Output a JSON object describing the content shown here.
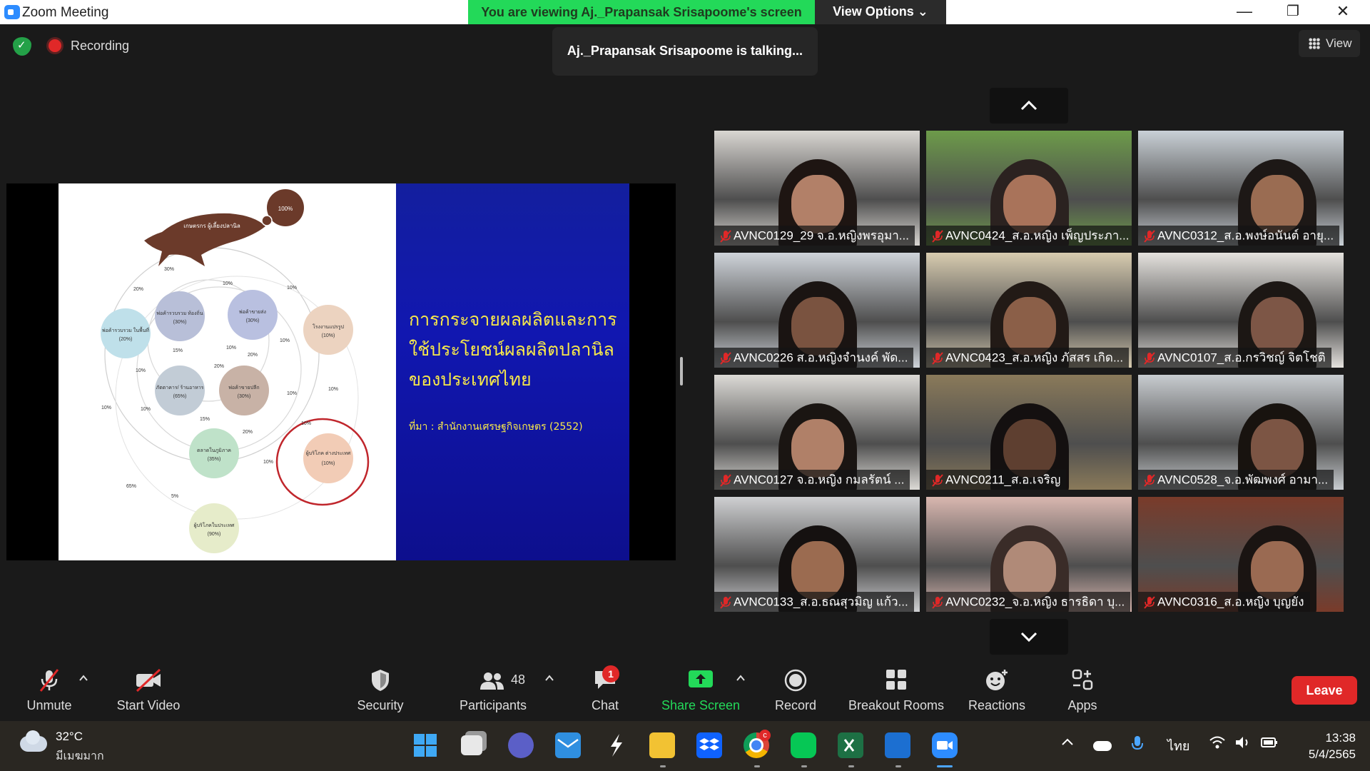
{
  "window": {
    "title": "Zoom Meeting",
    "sharing_banner": "You are viewing Aj._Prapansak  Srisapoome's screen",
    "view_options": "View Options ⌄",
    "minimize": "—",
    "maximize": "❐",
    "close": "✕"
  },
  "status": {
    "recording_label": "Recording",
    "talking_label": "Aj._Prapansak  Srisapoome is talking...",
    "view_label": "View"
  },
  "slide": {
    "heading": "การกระจายผลผลิตและการใช้ประโยชน์ผลผลิตปลานิล ของประเทศไทย",
    "source": "ที่มา : สำนักงานเศรษฐกิจเกษตร (2552)",
    "diagram": {
      "fish_label": "เกษตรกร ผู้เลี้ยงปลานิล",
      "fish_pct": "100%",
      "nodes": [
        {
          "label": "พ่อค้ารวบรวม ในพื้นที่",
          "pct": "(20%)"
        },
        {
          "label": "พ่อค้ารวบรวม ท้องถิ่น",
          "pct": "(30%)"
        },
        {
          "label": "พ่อค้าขายส่ง",
          "pct": "(30%)"
        },
        {
          "label": "โรงงานแปรรูป",
          "pct": "(10%)"
        },
        {
          "label": "ภัตตาคาร/ ร้านอาหาร",
          "pct": "(65%)"
        },
        {
          "label": "พ่อค้าขายปลีก",
          "pct": "(30%)"
        },
        {
          "label": "ตลาดในภูมิภาค",
          "pct": "(35%)"
        },
        {
          "label": "ผู้บริโภค ต่างประเทศ",
          "pct": "(10%)"
        },
        {
          "label": "ผู้บริโภคในประเทศ",
          "pct": "(90%)"
        }
      ],
      "flow_labels": [
        "30%",
        "10%",
        "10%",
        "20%",
        "15%",
        "10%",
        "20%",
        "10%",
        "10%",
        "10%",
        "20%",
        "15%",
        "20%",
        "10%",
        "10%",
        "10%",
        "65%",
        "5%",
        "10%",
        "10%"
      ]
    }
  },
  "participants": [
    {
      "name": "AVNC0129_29 จ.อ.หญิงพรอุมา...",
      "bg": "#d9d6d2",
      "skin": "#b28068",
      "hair": "#1e1512"
    },
    {
      "name": "AVNC0424_ส.อ.หญิง เพ็ญประภา...",
      "bg": "#6d9b4a",
      "skin": "#a9735a",
      "hair": "#2b2220"
    },
    {
      "name": "AVNC0312_ส.อ.พงษ์อนันต์ อายุ...",
      "bg": "#c9d0d6",
      "skin": "#9a6c52",
      "hair": "#1d1816"
    },
    {
      "name": "AVNC0226 ส.อ.หญิงจำนงค์ พัด...",
      "bg": "#cfd4da",
      "skin": "#7a5340",
      "hair": "#1a1412"
    },
    {
      "name": "AVNC0423_ส.อ.หญิง ภัสสร เกิด...",
      "bg": "#d8ccb0",
      "skin": "#8b5f48",
      "hair": "#221a16"
    },
    {
      "name": "AVNC0107_ส.อ.กรวิชญ์ จิตโชติ",
      "bg": "#e5e2de",
      "skin": "#7d5646",
      "hair": "#1c1714"
    },
    {
      "name": "AVNC0127 จ.อ.หญิง กมลรัตน์ ...",
      "bg": "#dcdad6",
      "skin": "#b08068",
      "hair": "#1a1512"
    },
    {
      "name": "AVNC0211_ส.อ.เจริญ",
      "bg": "#8a7a5a",
      "skin": "#5e3f30",
      "hair": "#141010"
    },
    {
      "name": "AVNC0528_จ.อ.พัฒพงศ์ อามา...",
      "bg": "#c8ccd0",
      "skin": "#7c5544",
      "hair": "#18130f"
    },
    {
      "name": "AVNC0133_ส.อ.ธณสุวมิญ แก้ว...",
      "bg": "#cfd0d2",
      "skin": "#9b6b50",
      "hair": "#151110"
    },
    {
      "name": "AVNC0232_จ.อ.หญิง ธารธิดา บุ...",
      "bg": "#d9b7b0",
      "skin": "#b08a78",
      "hair": "#3a2c28"
    },
    {
      "name": "AVNC0316_ส.อ.หญิง บุญยัง",
      "bg": "#7a3b2a",
      "skin": "#9a6a52",
      "hair": "#1a1412"
    }
  ],
  "toolbar": {
    "unmute": "Unmute",
    "start_video": "Start Video",
    "security": "Security",
    "participants": "Participants",
    "participants_count": "48",
    "chat": "Chat",
    "chat_badge": "1",
    "share_screen": "Share Screen",
    "record": "Record",
    "breakout_rooms": "Breakout Rooms",
    "reactions": "Reactions",
    "apps": "Apps",
    "leave": "Leave",
    "share_color": "#23d959"
  },
  "taskbar": {
    "temperature": "32°C",
    "weather": "มีเมฆมาก",
    "language": "ไทย",
    "time": "13:38",
    "date": "5/4/2565",
    "chrome_badge": "c"
  }
}
